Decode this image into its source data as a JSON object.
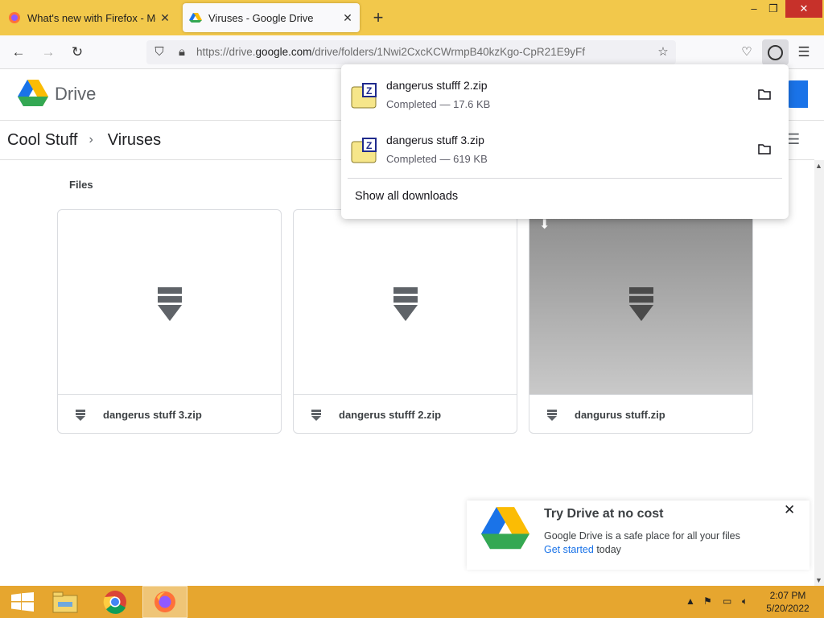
{
  "browser": {
    "tabs": [
      {
        "title": "What's new with Firefox - More",
        "icon": "firefox-icon",
        "active": false
      },
      {
        "title": "Viruses - Google Drive",
        "icon": "google-drive-icon",
        "active": true
      }
    ],
    "url_prefix": "https://drive.",
    "url_domain": "google.com",
    "url_path": "/drive/folders/1Nwi2CxcKCWrmpB40kzKgo-CpR21E9yFf"
  },
  "drive": {
    "app_name": "Drive",
    "breadcrumb": [
      "Cool Stuff",
      "Viruses"
    ],
    "section_label": "Files",
    "files": [
      {
        "name": "dangerus stuff 3.zip",
        "icon": "zip-icon"
      },
      {
        "name": "dangerus stufff 2.zip",
        "icon": "zip-icon"
      },
      {
        "name": "dangurus stuff.zip",
        "icon": "zip-icon"
      }
    ]
  },
  "downloads": {
    "items": [
      {
        "name": "dangerus stufff 2.zip",
        "status": "Completed — 17.6 KB"
      },
      {
        "name": "dangerus stuff 3.zip",
        "status": "Completed — 619 KB"
      }
    ],
    "show_all": "Show all downloads"
  },
  "promo": {
    "title": "Try Drive at no cost",
    "description": "Google Drive is a safe place for all your files",
    "link": "Get started",
    "suffix": " today"
  },
  "taskbar": {
    "time": "2:07 PM",
    "date": "5/20/2022"
  }
}
